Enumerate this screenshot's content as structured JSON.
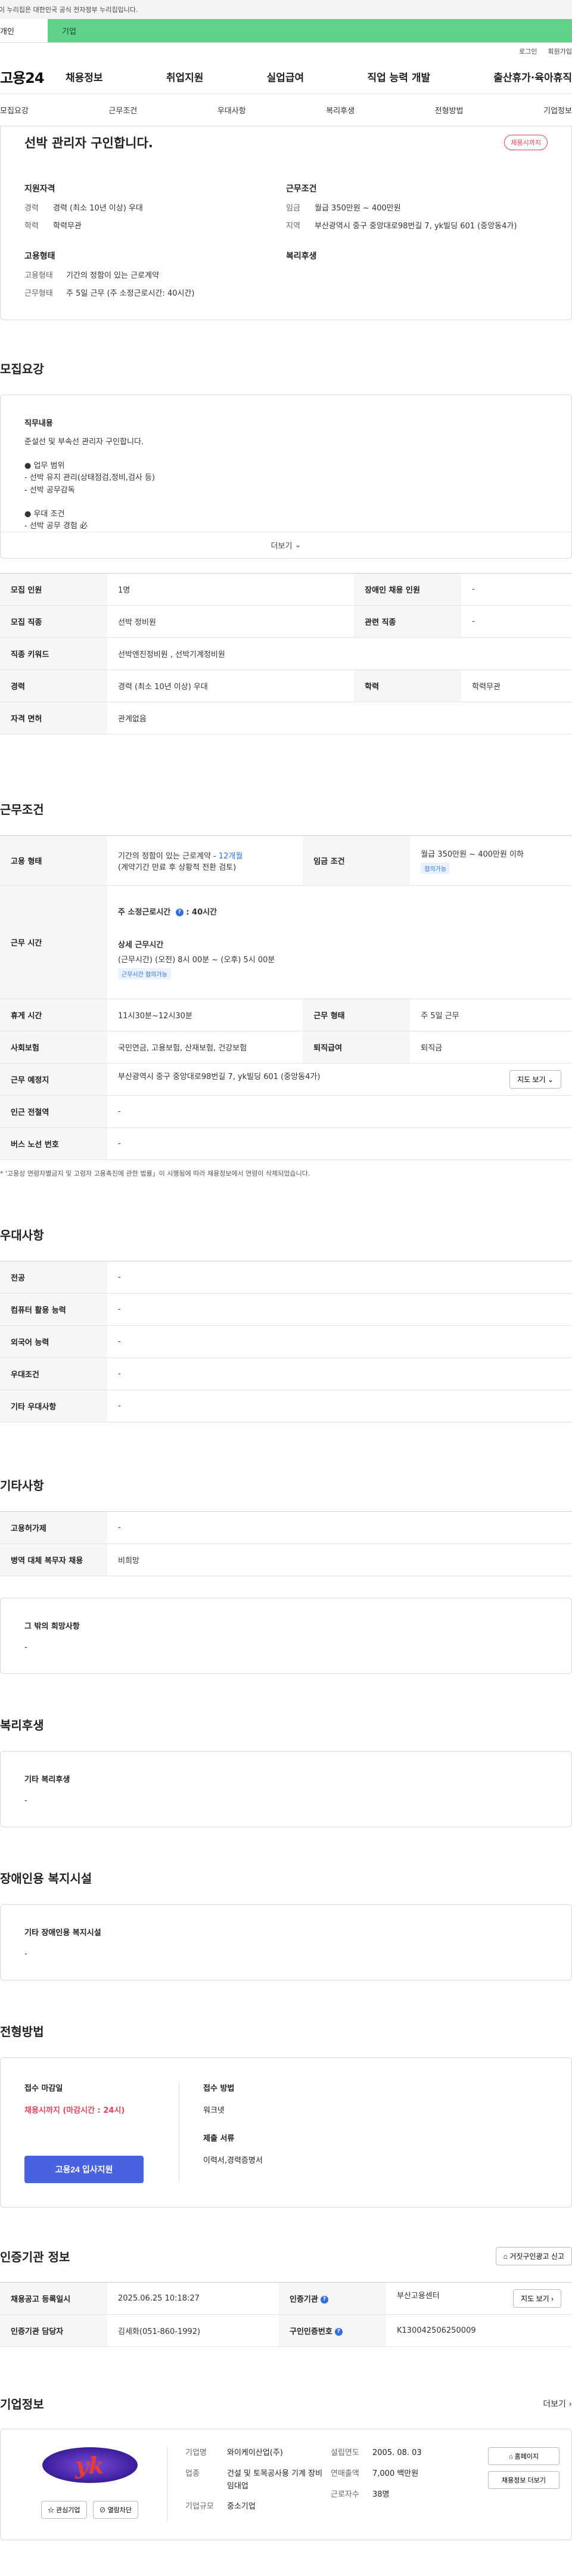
{
  "gov_bar": "이 누리집은 대한민국 공식 전자정부 누리집입니다.",
  "user_tabs": [
    "개인",
    "기업"
  ],
  "util": [
    "로그인",
    "회원가입"
  ],
  "logo": "고용24",
  "gnb": [
    "채용정보",
    "취업지원",
    "실업급여",
    "직업 능력 개발",
    "출산휴가·육아휴직"
  ],
  "subnav": [
    "모집요강",
    "근무조건",
    "우대사항",
    "복리후생",
    "전형방법",
    "기업정보"
  ],
  "summary": {
    "title": "선박 관리자 구인합니다.",
    "badge": "채용시까지",
    "qual_head": "지원자격",
    "qual": [
      {
        "k": "경력",
        "v": "경력 (최소 10년 이상) 우대"
      },
      {
        "k": "학력",
        "v": "학력무관"
      }
    ],
    "emp_head": "고용형태",
    "emp": [
      {
        "k": "고용형태",
        "v": "기간의 정함이 있는 근로계약"
      },
      {
        "k": "근무형태",
        "v": "주 5일 근무 (주 소정근로시간: 40시간)"
      }
    ],
    "cond_head": "근무조건",
    "cond": [
      {
        "k": "임금",
        "v": "월급 350만원 ~ 400만원"
      },
      {
        "k": "지역",
        "v": "부산광역시 중구 중앙대로98번길 7, yk빌딩 601 (중앙동4가)"
      }
    ],
    "welfare_head": "복리후생"
  },
  "recruit": {
    "title": "모집요강",
    "sub": "직무내용",
    "body": "준설선 및 부속선 관리자 구인합니다.\n\n● 업무 범위\n  - 선박 유지 관리(상태점검,정비,검사 등)\n  - 선박 공무감독\n\n● 우대 조건\n  - 선박 공무 경험 必\n  - 해기사 (기관) 승선경력",
    "more": "더보기",
    "rows": [
      [
        "모집 인원",
        "1명",
        "장애인 채용 인원",
        "-"
      ],
      [
        "모집 직종",
        "선박 정비원",
        "관련 직종",
        "-"
      ],
      [
        "직종 키워드",
        "선박엔진정비원 , 선박기계정비원"
      ],
      [
        "경력",
        "경력 (최소 10년 이상) 우대",
        "학력",
        "학력무관"
      ],
      [
        "자격 면허",
        "관계없음"
      ]
    ]
  },
  "work": {
    "title": "근무조건",
    "emp_label": "고용 형태",
    "emp_val": "기간의 정함이 있는 근로계약 - ",
    "emp_months": "12개월",
    "emp_note": "(계약기간 만료 후 상황적 전환 검토)",
    "wage_label": "임금 조건",
    "wage_val": "월급 350만원 ~ 400만원 이하",
    "wage_chip": "협의가능",
    "time_label": "근무 시간",
    "time_weekly": "주 소정근로시간",
    "time_weekly_val": "40시간",
    "time_detail_head": "상세 근무시간",
    "time_detail": "(근무시간) (오전) 8시 00분 ~ (오후) 5시 00분",
    "time_chip": "근무시간 협의가능",
    "rows": [
      [
        "휴게 시간",
        "11시30분~12시30분",
        "근무 형태",
        "주 5일 근무"
      ],
      [
        "사회보험",
        "국민연금, 고용보험, 산재보험, 건강보험",
        "퇴직급여",
        "퇴직금"
      ]
    ],
    "place_label": "근무 예정지",
    "place_val": "부산광역시 중구 중앙대로98번길 7, yk빌딩 601 (중앙동4가)",
    "map_btn": "지도 보기",
    "rows2": [
      [
        "인근 전철역",
        "-"
      ],
      [
        "버스 노선 번호",
        "-"
      ]
    ],
    "note": "* '고용상 연령차별금지 및 고령자 고용촉진에 관한 법률」이 시행됨에 따라 채용정보에서 연령이 삭제되었습니다."
  },
  "pref": {
    "title": "우대사항",
    "rows": [
      [
        "전공",
        "-"
      ],
      [
        "컴퓨터 활용 능력",
        "-"
      ],
      [
        "외국어 능력",
        "-"
      ],
      [
        "우대조건",
        "-"
      ],
      [
        "기타 우대사항",
        "-"
      ]
    ]
  },
  "etc": {
    "title": "기타사항",
    "rows": [
      [
        "고용허가제",
        "-"
      ],
      [
        "병역 대체 복무자 채용",
        "비희망"
      ]
    ],
    "box_sub": "그 밖의 희망사항",
    "box_val": "-"
  },
  "welfare": {
    "title": "복리후생",
    "sub": "기타 복리후생",
    "val": "-"
  },
  "disab": {
    "title": "장애인용 복지시설",
    "sub": "기타 장애인용 복지시설",
    "val": "-"
  },
  "screen": {
    "title": "전형방법",
    "deadline_label": "접수 마감일",
    "deadline_val": "채용시까지 (마감시간 : 24시)",
    "apply_btn": "고용24 입사지원",
    "method_label": "접수 방법",
    "method_val": "워크넷",
    "docs_label": "제출 서류",
    "docs_val": "이력서,경력증명서"
  },
  "cert": {
    "title": "인증기관 정보",
    "report_btn": "거짓구인광고 신고",
    "r1": [
      "채용공고 등록일시",
      "2025.06.25 10:18:27",
      "인증기관",
      "부산고용센터"
    ],
    "map_btn": "지도 보기",
    "r2": [
      "인증기관 담당자",
      "김세화(051-860-1992)",
      "구인인증번호",
      "K130042506250009"
    ]
  },
  "company": {
    "title": "기업정보",
    "more": "더보기",
    "logo_text": "yk",
    "fav_btn": "관심기업",
    "block_btn": "열람차단",
    "left": [
      {
        "k": "기업명",
        "v": "와이케이산업(주)"
      },
      {
        "k": "업종",
        "v": "건설 및 토목공사용 기계 장비 임대업"
      },
      {
        "k": "기업규모",
        "v": "중소기업"
      }
    ],
    "right": [
      {
        "k": "설립연도",
        "v": "2005. 08. 03"
      },
      {
        "k": "연매출액",
        "v": "7,000 백만원"
      },
      {
        "k": "근로자수",
        "v": "38명"
      }
    ],
    "home_btn": "홈페이지",
    "jobs_btn": "채용정보 더보기"
  }
}
